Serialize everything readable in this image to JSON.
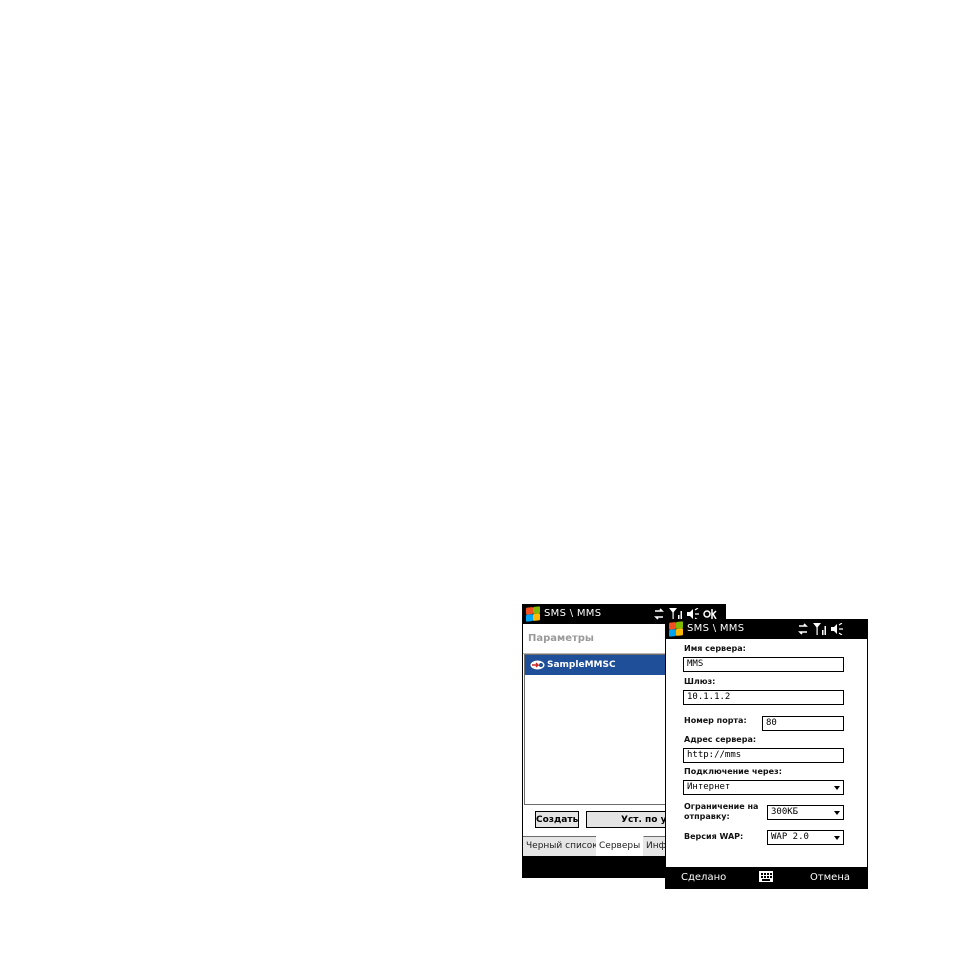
{
  "colors": {
    "titlebar": "#000000",
    "selection": "#1f4f98",
    "win_logo": [
      "#f25022",
      "#7fba00",
      "#00a4ef",
      "#ffb900"
    ]
  },
  "back_screen": {
    "title": "SMS \\ MMS",
    "status_icons": [
      "connectivity-icon",
      "signal-icon",
      "volume-icon",
      "ok-icon"
    ],
    "header": "Параметры",
    "list_items": [
      {
        "label": "SampleMMSC",
        "icon": "server-icon",
        "selected": true
      }
    ],
    "buttons": {
      "create": "Создать",
      "set_default": "Уст. по умолч"
    },
    "tabs": [
      {
        "label": "Черный список",
        "active": false
      },
      {
        "label": "Серверы",
        "active": true
      },
      {
        "label": "Инфо",
        "active": false
      }
    ]
  },
  "front_screen": {
    "title": "SMS \\ MMS",
    "status_icons": [
      "connectivity-icon",
      "signal-icon",
      "volume-icon"
    ],
    "fields": {
      "server_name": {
        "label": "Имя сервера:",
        "value": "MMS"
      },
      "gateway": {
        "label": "Шлюз:",
        "value": "10.1.1.2"
      },
      "port": {
        "label": "Номер порта:",
        "value": "80"
      },
      "server_address": {
        "label": "Адрес сервера:",
        "value": "http://mms"
      },
      "connect_via": {
        "label": "Подключение через:",
        "value": "Интернет"
      },
      "send_limit": {
        "label_line1": "Ограничение на",
        "label_line2": "отправку:",
        "value": "300KБ"
      },
      "wap_version": {
        "label": "Версия WAP:",
        "value": "WAP 2.0"
      }
    },
    "softkeys": {
      "left": "Сделано",
      "right": "Отмена",
      "center_icon": "keyboard-icon"
    }
  }
}
